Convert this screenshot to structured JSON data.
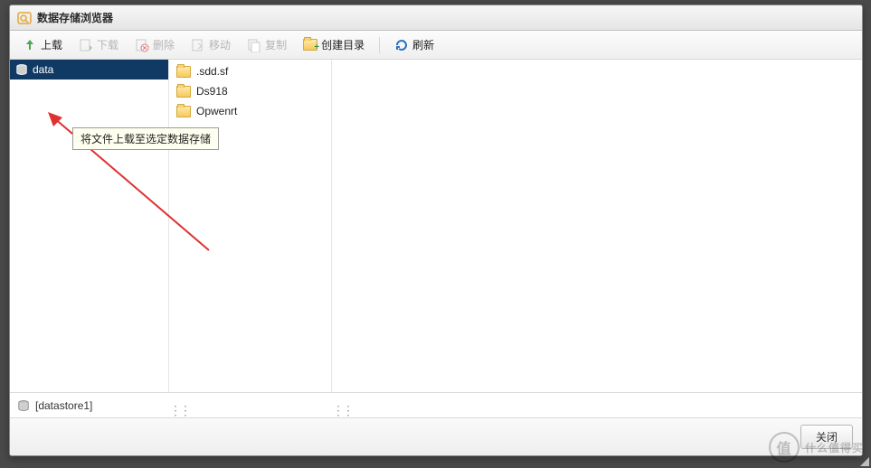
{
  "titlebar": {
    "title": "数据存储浏览器"
  },
  "toolbar": {
    "upload": "上载",
    "download": "下载",
    "delete": "删除",
    "move": "移动",
    "copy": "复制",
    "mkdir": "创建目录",
    "refresh": "刷新"
  },
  "tooltip": "将文件上载至选定数据存储",
  "tree": {
    "root": "datastore1"
  },
  "tree_visible_prefix": "data",
  "files": [
    {
      "name": ".sdd.sf",
      "type": "folder"
    },
    {
      "name": "Ds918",
      "type": "folder"
    },
    {
      "name": "Opwenrt",
      "type": "folder"
    }
  ],
  "status": {
    "path": "[datastore1]"
  },
  "footer": {
    "close": "关闭"
  },
  "watermark": {
    "badge": "值",
    "text": "什么值得买"
  }
}
